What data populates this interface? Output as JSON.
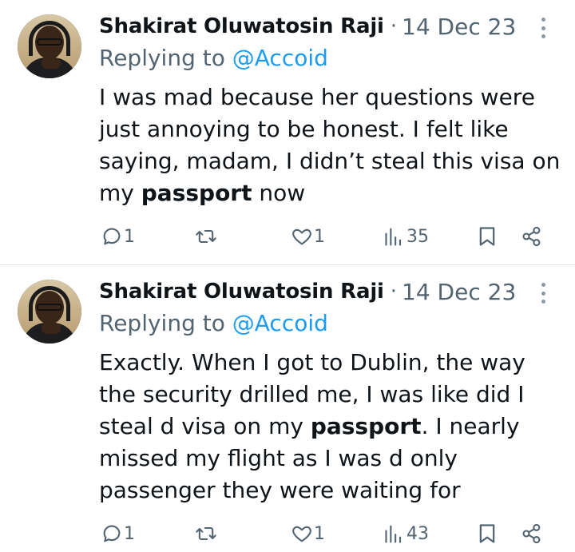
{
  "tweets": [
    {
      "name": "Shakirat Oluwatosin Raji",
      "date": "14 Dec 23",
      "replying_prefix": "Replying to ",
      "replying_handle": "@Accoid",
      "text_before": "I was mad because her questions were just annoying to be honest. I felt like saying, madam, I didn’t steal this visa on my ",
      "text_bold": "passport",
      "text_after": " now",
      "replies": "1",
      "retweets": "",
      "likes": "1",
      "views": "35"
    },
    {
      "name": "Shakirat Oluwatosin Raji",
      "date": "14 Dec 23",
      "replying_prefix": "Replying to ",
      "replying_handle": "@Accoid",
      "text_before": "Exactly. When I got to Dublin, the way the security drilled me, I was like did I steal d visa on my ",
      "text_bold": "passport",
      "text_after": ". I nearly missed my flight as I was d only passenger they were waiting for",
      "replies": "1",
      "retweets": "",
      "likes": "1",
      "views": "43"
    }
  ],
  "icons": {
    "reply": "speech-bubble-icon",
    "retweet": "retweet-arrows-icon",
    "like": "heart-icon",
    "views": "bar-chart-icon",
    "bookmark": "bookmark-icon",
    "share": "share-icon",
    "more": "vertical-dots-icon"
  },
  "colors": {
    "text": "#0f1419",
    "secondary": "#536471",
    "link": "#1d9bf0",
    "divider": "#e4e7ea"
  }
}
